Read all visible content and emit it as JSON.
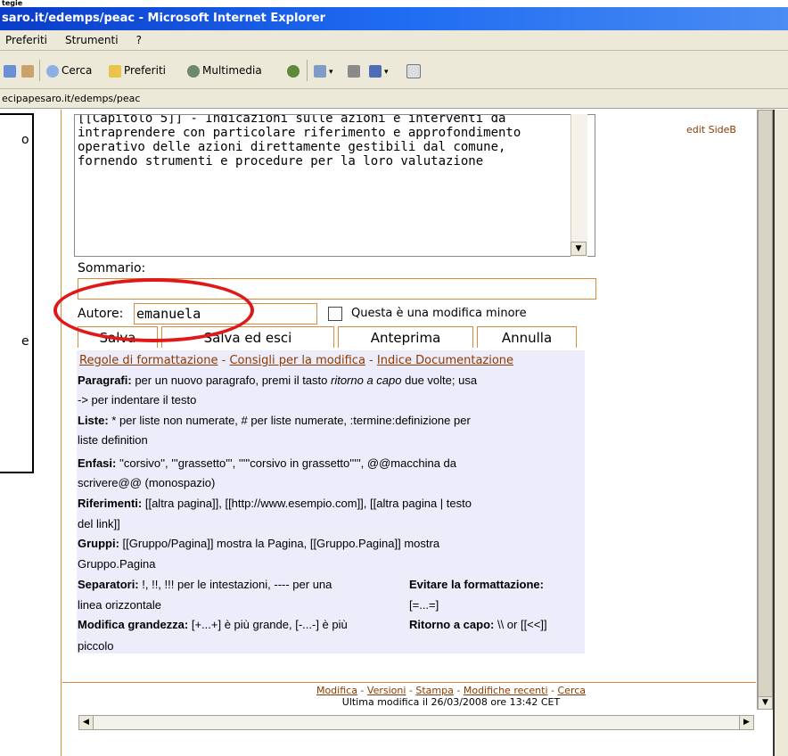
{
  "window": {
    "top_fragment": "tegie",
    "title": "saro.it/edemps/peac - Microsoft Internet Explorer"
  },
  "menu": [
    "Preferiti",
    "Strumenti",
    "?"
  ],
  "toolbar": {
    "search": "Cerca",
    "favorites": "Preferiti",
    "multimedia": "Multimedia"
  },
  "address": "ecipapesaro.it/edemps/peac",
  "left_panel": {
    "frag1": "o",
    "frag2": "e"
  },
  "editor": {
    "text_lines": [
      "[[Capitolo 5]] - Indicazioni sulle azioni e interventi da",
      "intraprendere con particolare riferimento e approfondimento",
      "operativo delle azioni direttamente gestibili dal comune,",
      "fornendo strumenti e procedure per la loro valutazione"
    ],
    "side_link": "edit SideB"
  },
  "form": {
    "sommario_label": "Sommario:",
    "autore_label": "Autore:",
    "autore_value": "emanuela",
    "minor_label": "Questa è una modifica minore"
  },
  "buttons": {
    "salva": "Salva",
    "salva_esci": "Salva ed esci",
    "anteprima": "Anteprima",
    "annulla": "Annulla"
  },
  "help": {
    "links": [
      "Regole di formattazione",
      "Consigli per la modifica",
      "Indice Documentazione"
    ],
    "link_sep": " - ",
    "paragrafi_b": "Paragrafi:",
    "paragrafi_1": " per un nuovo paragrafo, premi il tasto ",
    "paragrafi_i": "ritorno a capo",
    "paragrafi_2": " due volte; usa",
    "paragrafi_3": "-> per indentare il testo",
    "liste_b": "Liste:",
    "liste_1": " * per liste non numerate, # per liste numerate, :termine:definizione per",
    "liste_2": "liste definition",
    "enfasi_b": "Enfasi:",
    "enfasi_1": " ''corsivo'', '''grassetto''', '''''corsivo in grassetto''''', @@macchina da",
    "enfasi_2": "scrivere@@ (monospazio)",
    "rif_b": "Riferimenti:",
    "rif_1": " [[altra pagina]], [[http://www.esempio.com]], [[altra pagina | testo",
    "rif_2": "del link]]",
    "gruppi_b": "Gruppi:",
    "gruppi_1": " [[Gruppo/Pagina]] mostra la Pagina, [[Gruppo.Pagina]] mostra",
    "gruppi_2": "Gruppo.Pagina",
    "sep_b": "Separatori:",
    "sep_1": " !, !!, !!! per le intestazioni, ---- per una",
    "sep_2": "linea orizzontale",
    "evitare_b": "Evitare la formattazione:",
    "evitare_1": "[=...=]",
    "mod_b": "Modifica grandezza:",
    "mod_1": " [+...+] è più grande, [-...-] è più",
    "mod_2": "piccolo",
    "ritorno_b": "Ritorno a capo:",
    "ritorno_1": " \\\\ or [[<<]]"
  },
  "footer": {
    "links": [
      "Modifica",
      "Versioni",
      "Stampa",
      "Modifiche recenti",
      "Cerca"
    ],
    "sep": " - ",
    "last_modified": "Ultima modifica il 26/03/2008 ore 13:42 CET"
  },
  "colors": {
    "accent": "#d98a3a",
    "link": "#8c3a00",
    "help_bg": "#ececfb",
    "highlight_oval": "#e01818"
  }
}
